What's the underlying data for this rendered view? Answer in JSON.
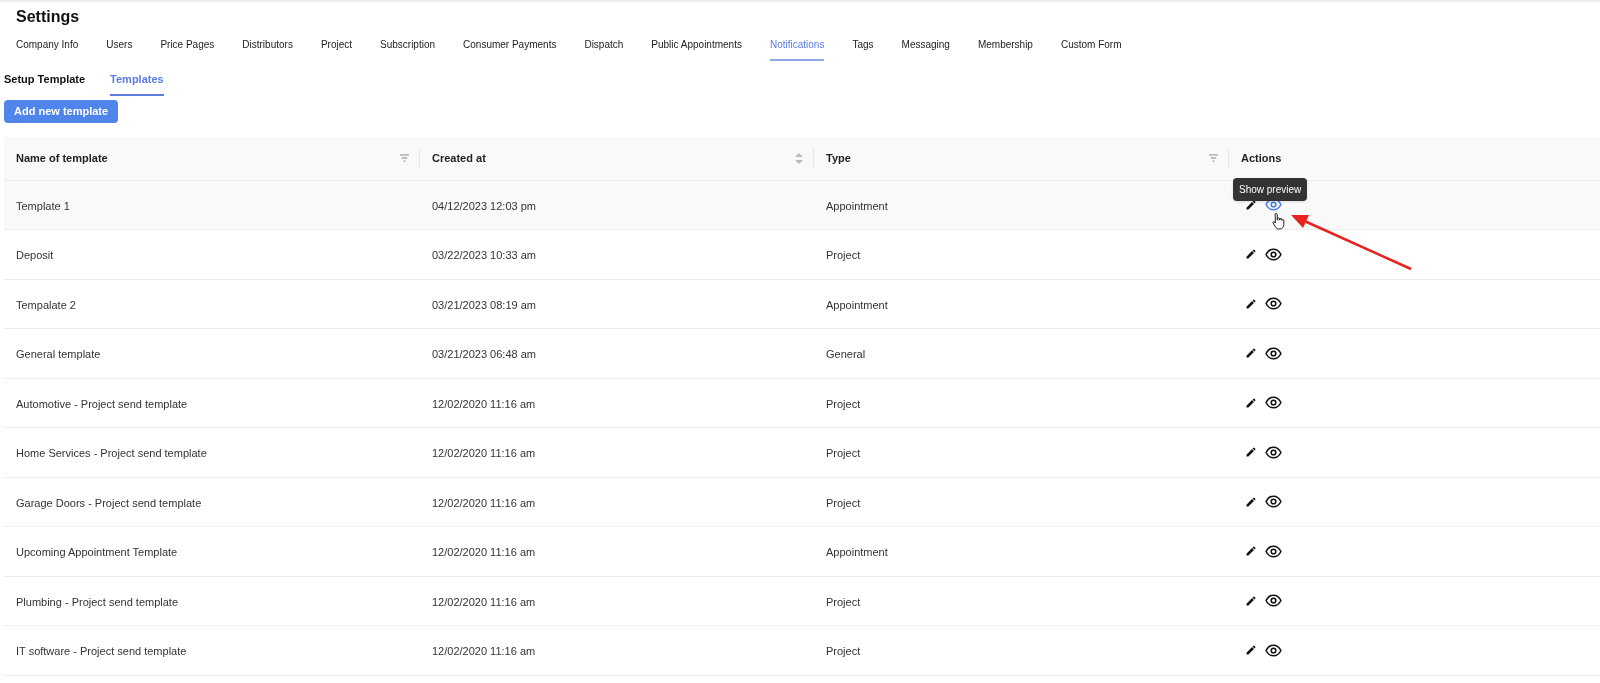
{
  "page": {
    "title": "Settings"
  },
  "tabs": [
    {
      "label": "Company Info",
      "selected": false
    },
    {
      "label": "Users",
      "selected": false
    },
    {
      "label": "Price Pages",
      "selected": false
    },
    {
      "label": "Distributors",
      "selected": false
    },
    {
      "label": "Project",
      "selected": false
    },
    {
      "label": "Subscription",
      "selected": false
    },
    {
      "label": "Consumer Payments",
      "selected": false
    },
    {
      "label": "Dispatch",
      "selected": false
    },
    {
      "label": "Public Appointments",
      "selected": false
    },
    {
      "label": "Notifications",
      "selected": true
    },
    {
      "label": "Tags",
      "selected": false
    },
    {
      "label": "Messaging",
      "selected": false
    },
    {
      "label": "Membership",
      "selected": false
    },
    {
      "label": "Custom Form",
      "selected": false
    }
  ],
  "subtabs": [
    {
      "label": "Setup Template",
      "selected": false
    },
    {
      "label": "Templates",
      "selected": true
    }
  ],
  "add_button": "Add new template",
  "table": {
    "columns": [
      {
        "label": "Name of template",
        "kind": "filter"
      },
      {
        "label": "Created at",
        "kind": "sort"
      },
      {
        "label": "Type",
        "kind": "filter"
      },
      {
        "label": "Actions",
        "kind": "plain"
      }
    ],
    "rows": [
      {
        "name": "Template 1",
        "created": "04/12/2023 12:03 pm",
        "type": "Appointment",
        "hovered": true
      },
      {
        "name": "Deposit",
        "created": "03/22/2023 10:33 am",
        "type": "Project",
        "hovered": false
      },
      {
        "name": "Tempalate 2",
        "created": "03/21/2023 08:19 am",
        "type": "Appointment",
        "hovered": false
      },
      {
        "name": "General template",
        "created": "03/21/2023 06:48 am",
        "type": "General",
        "hovered": false
      },
      {
        "name": "Automotive - Project send template",
        "created": "12/02/2020 11:16 am",
        "type": "Project",
        "hovered": false
      },
      {
        "name": "Home Services - Project send template",
        "created": "12/02/2020 11:16 am",
        "type": "Project",
        "hovered": false
      },
      {
        "name": "Garage Doors - Project send template",
        "created": "12/02/2020 11:16 am",
        "type": "Project",
        "hovered": false
      },
      {
        "name": "Upcoming Appointment Template",
        "created": "12/02/2020 11:16 am",
        "type": "Appointment",
        "hovered": false
      },
      {
        "name": "Plumbing - Project send template",
        "created": "12/02/2020 11:16 am",
        "type": "Project",
        "hovered": false
      },
      {
        "name": "IT software - Project send template",
        "created": "12/02/2020 11:16 am",
        "type": "Project",
        "hovered": false
      }
    ]
  },
  "tooltip": {
    "text": "Show preview"
  }
}
